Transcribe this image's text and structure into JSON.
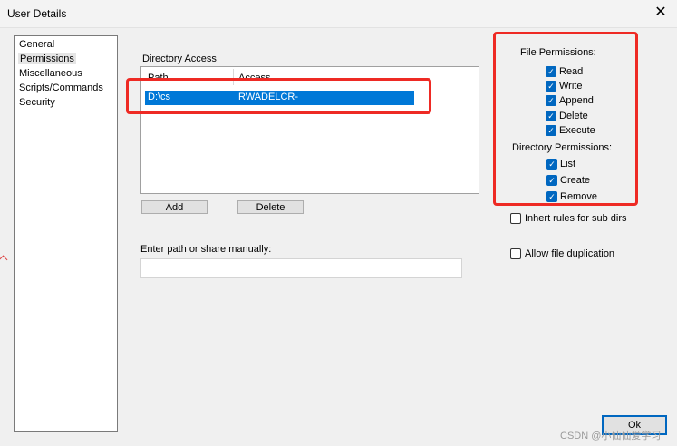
{
  "window": {
    "title": "User Details",
    "close_glyph": "✕"
  },
  "nav": {
    "items": [
      "General",
      "Permissions",
      "Miscellaneous",
      "Scripts/Commands",
      "Security"
    ],
    "selected": "Permissions"
  },
  "directory_access": {
    "label": "Directory Access",
    "columns": {
      "path": "Path",
      "access": "Access"
    },
    "rows": [
      {
        "path": "D:\\cs",
        "access": "RWADELCR-"
      }
    ],
    "add_label": "Add",
    "delete_label": "Delete"
  },
  "manual": {
    "label": "Enter path or share manually:",
    "value": ""
  },
  "file_permissions": {
    "label": "File Permissions:",
    "items": [
      {
        "label": "Read",
        "checked": true
      },
      {
        "label": "Write",
        "checked": true
      },
      {
        "label": "Append",
        "checked": true
      },
      {
        "label": "Delete",
        "checked": true
      },
      {
        "label": "Execute",
        "checked": true
      }
    ]
  },
  "directory_permissions": {
    "label": "Directory Permissions:",
    "items": [
      {
        "label": "List",
        "checked": true
      },
      {
        "label": "Create",
        "checked": true
      },
      {
        "label": "Remove",
        "checked": true
      }
    ]
  },
  "options": {
    "inherit": {
      "label": "Inhert rules for sub dirs",
      "checked": false
    },
    "allow_dup": {
      "label": "Allow file duplication",
      "checked": false
    }
  },
  "ok_label": "Ok",
  "watermark": "CSDN @小仙仙爱学习",
  "colors": {
    "highlight_red": "#ee2a24",
    "selection_blue": "#0078d7",
    "checkbox_blue": "#0067c0"
  },
  "icons": {
    "checkmark": "✓"
  }
}
